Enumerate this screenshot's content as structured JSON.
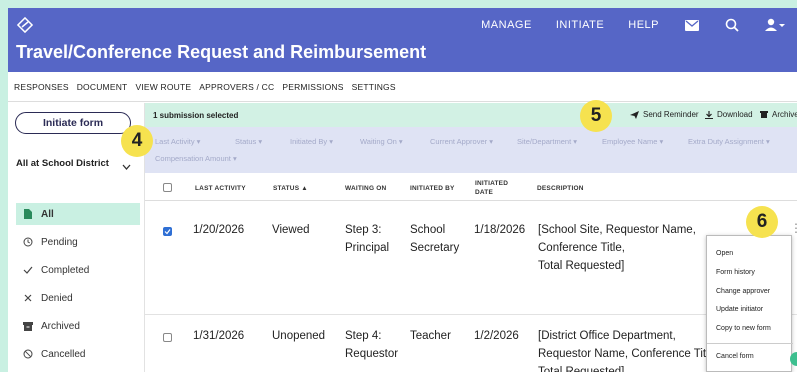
{
  "header": {
    "title": "Travel/Conference Request and Reimbursement",
    "nav": [
      "MANAGE",
      "INITIATE",
      "HELP"
    ],
    "icons": [
      "mail-icon",
      "search-icon",
      "user-icon"
    ]
  },
  "subnav": [
    "RESPONSES",
    "DOCUMENT",
    "VIEW ROUTE",
    "APPROVERS / CC",
    "PERMISSIONS",
    "SETTINGS"
  ],
  "sidebar": {
    "initiate_label": "Initiate form",
    "scope": "All at School District",
    "items": [
      {
        "label": "All",
        "icon": "document-icon"
      },
      {
        "label": "Pending",
        "icon": "clock-icon"
      },
      {
        "label": "Completed",
        "icon": "check-icon"
      },
      {
        "label": "Denied",
        "icon": "x-icon"
      },
      {
        "label": "Archived",
        "icon": "archive-icon"
      },
      {
        "label": "Cancelled",
        "icon": "cancel-icon"
      }
    ]
  },
  "banner": {
    "selected": "1 submission selected",
    "send_reminder": "Send Reminder",
    "download": "Download",
    "archive": "Archive"
  },
  "filters": [
    "Last Activity ▾",
    "Status ▾",
    "Initiated By ▾",
    "Waiting On ▾",
    "Current Approver ▾",
    "Site/Department ▾",
    "Employee Name ▾",
    "Extra Duty Assignment ▾",
    "Compensation Amount ▾"
  ],
  "table": {
    "headers": [
      "LAST ACTIVITY",
      "STATUS ▲",
      "WAITING ON",
      "INITIATED BY",
      "INITIATED\nDATE",
      "DESCRIPTION"
    ],
    "rows": [
      {
        "checked": true,
        "last_activity": "1/20/2026",
        "status": "Viewed",
        "waiting_on": [
          "Step 3:",
          "Principal"
        ],
        "initiated_by": [
          "School",
          "Secretary"
        ],
        "initiated_date": "1/18/2026",
        "description": [
          "[School Site, Requestor Name,",
          "Conference Title,",
          "Total Requested]"
        ]
      },
      {
        "checked": false,
        "last_activity": "1/31/2026",
        "status": "Unopened",
        "waiting_on": [
          "Step 4:",
          "Requestor"
        ],
        "initiated_by": [
          "Teacher"
        ],
        "initiated_date": "1/2/2026",
        "description": [
          "[District Office Department,",
          "Requestor Name, Conference Title,",
          "Total Requested]"
        ]
      }
    ]
  },
  "context_menu": [
    "Open",
    "Form history",
    "Change approver",
    "Update initiator",
    "Copy to new form",
    "Cancel form"
  ],
  "callouts": [
    "4",
    "5",
    "6"
  ],
  "colors": {
    "header": "#5666c6",
    "banner": "#d2f1e4",
    "callout": "#f6e24f",
    "background": "#c9f0e2"
  }
}
